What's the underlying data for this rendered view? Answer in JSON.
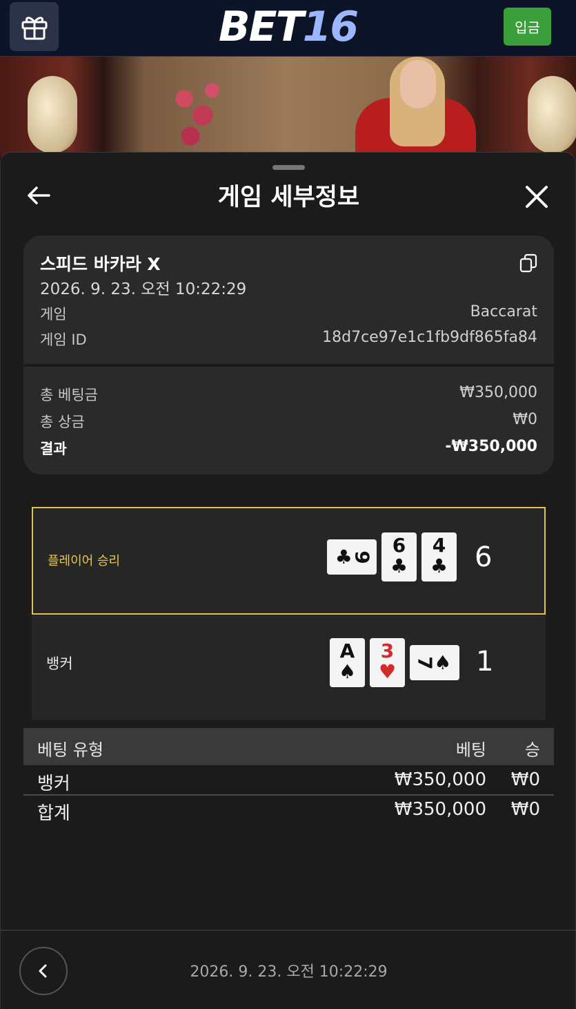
{
  "header": {
    "logo_part1": "BET",
    "logo_part2": "16",
    "deposit_label": "입금"
  },
  "sheet": {
    "title": "게임 세부정보"
  },
  "game_info": {
    "name": "스피드 바카라 X",
    "datetime": "2026. 9. 23. 오전 10:22:29",
    "game_label": "게임",
    "game_value": "Baccarat",
    "game_id_label": "게임 ID",
    "game_id_value": "18d7ce97e1c1fb9df865fa84"
  },
  "summary": {
    "total_bet_label": "총 베팅금",
    "total_bet_value": "₩350,000",
    "total_win_label": "총 상금",
    "total_win_value": "₩0",
    "result_label": "결과",
    "result_value": "-₩350,000"
  },
  "outcome": {
    "player": {
      "label": "플레이어 승리",
      "score": "6",
      "cards": [
        {
          "rank": "9",
          "suit": "♣",
          "color": "black",
          "orientation": "side"
        },
        {
          "rank": "6",
          "suit": "♣",
          "color": "black",
          "orientation": "up"
        },
        {
          "rank": "4",
          "suit": "♣",
          "color": "black",
          "orientation": "up"
        }
      ]
    },
    "banker": {
      "label": "뱅커",
      "score": "1",
      "cards": [
        {
          "rank": "A",
          "suit": "♠",
          "color": "black",
          "orientation": "up"
        },
        {
          "rank": "3",
          "suit": "♥",
          "color": "red",
          "orientation": "up"
        },
        {
          "rank": "7",
          "suit": "♠",
          "color": "black",
          "orientation": "side"
        }
      ]
    }
  },
  "bet_table": {
    "headers": {
      "type": "베팅 유형",
      "bet": "베팅",
      "win": "승"
    },
    "rows": [
      {
        "type": "뱅커",
        "bet": "₩350,000",
        "win": "₩0"
      }
    ],
    "total": {
      "type": "합계",
      "bet": "₩350,000",
      "win": "₩0"
    }
  },
  "footer": {
    "datetime": "2026. 9. 23. 오전 10:22:29"
  },
  "colors": {
    "accent_gold": "#e2c64a",
    "deposit_green": "#3a9e3a",
    "logo_blue": "#9bb7ff"
  },
  "icons": [
    "gift-icon",
    "back-arrow-icon",
    "close-icon",
    "copy-icon",
    "chevron-left-icon"
  ]
}
